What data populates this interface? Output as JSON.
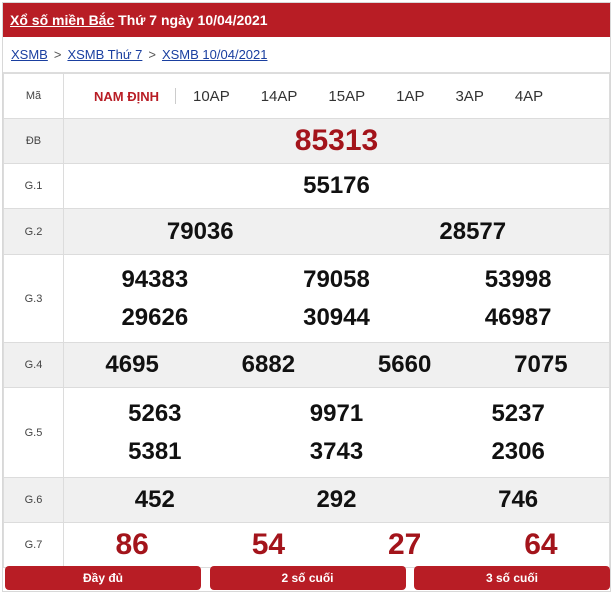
{
  "header": {
    "title_link": "Xổ số miền Bắc",
    "title_rest": "Thứ 7 ngày 10/04/2021"
  },
  "breadcrumb": {
    "items": [
      "XSMB",
      "XSMB Thứ 7",
      "XSMB 10/04/2021"
    ],
    "separator": ">"
  },
  "table": {
    "labels": {
      "code": "Mã",
      "db": "ĐB",
      "g1": "G.1",
      "g2": "G.2",
      "g3": "G.3",
      "g4": "G.4",
      "g5": "G.5",
      "g6": "G.6",
      "g7": "G.7"
    },
    "province": "NAM ĐỊNH",
    "codes": [
      "10AP",
      "14AP",
      "15AP",
      "1AP",
      "3AP",
      "4AP"
    ],
    "db": "85313",
    "g1": "55176",
    "g2": [
      "79036",
      "28577"
    ],
    "g3": [
      [
        "94383",
        "79058",
        "53998"
      ],
      [
        "29626",
        "30944",
        "46987"
      ]
    ],
    "g4": [
      "4695",
      "6882",
      "5660",
      "7075"
    ],
    "g5": [
      [
        "5263",
        "9971",
        "5237"
      ],
      [
        "5381",
        "3743",
        "2306"
      ]
    ],
    "g6": [
      "452",
      "292",
      "746"
    ],
    "g7": [
      "86",
      "54",
      "27",
      "64"
    ]
  },
  "buttons": {
    "full": "Đầy đủ",
    "last2": "2 số cuối",
    "last3": "3 số cuối"
  },
  "colors": {
    "brand_red": "#b81d25",
    "prize_red": "#a3141b",
    "link_blue": "#1a3fa0"
  }
}
